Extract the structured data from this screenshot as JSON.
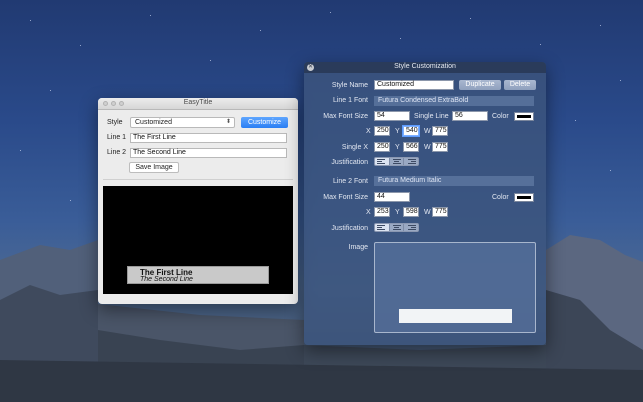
{
  "easytitle": {
    "window_title": "EasyTitle",
    "style_label": "Style",
    "style_value": "Customized",
    "customize_button": "Customize",
    "line1_label": "Line 1",
    "line1_value": "The First Line",
    "line2_label": "Line 2",
    "line2_value": "The Second Line",
    "save_button": "Save Image",
    "preview_line1": "The First Line",
    "preview_line2": "The Second Line"
  },
  "style_panel": {
    "window_title": "Style Customization",
    "style_name_label": "Style Name",
    "style_name_value": "Customized",
    "duplicate_button": "Duplicate",
    "delete_button": "Delete",
    "line1_font_label": "Line 1 Font",
    "line1_font_value": "Futura Condensed ExtraBold",
    "max_font_size_label": "Max Font Size",
    "line1_max_font_size": "54",
    "single_line_label": "Single Line",
    "single_line_value": "56",
    "color_label": "Color",
    "x_label": "X",
    "y_label": "Y",
    "w_label": "W",
    "line1_x": "250",
    "line1_y": "540",
    "line1_w": "775",
    "single_x_label": "Single X",
    "single_x": "250",
    "single_y": "566",
    "single_w": "775",
    "justification_label": "Justification",
    "line2_font_label": "Line 2 Font",
    "line2_font_value": "Futura Medium Italic",
    "line2_max_font_size": "44",
    "line2_x": "253",
    "line2_y": "598",
    "line2_w": "775",
    "image_label": "Image",
    "colors": {
      "line1_color": "#000000",
      "line2_color": "#000000"
    }
  }
}
